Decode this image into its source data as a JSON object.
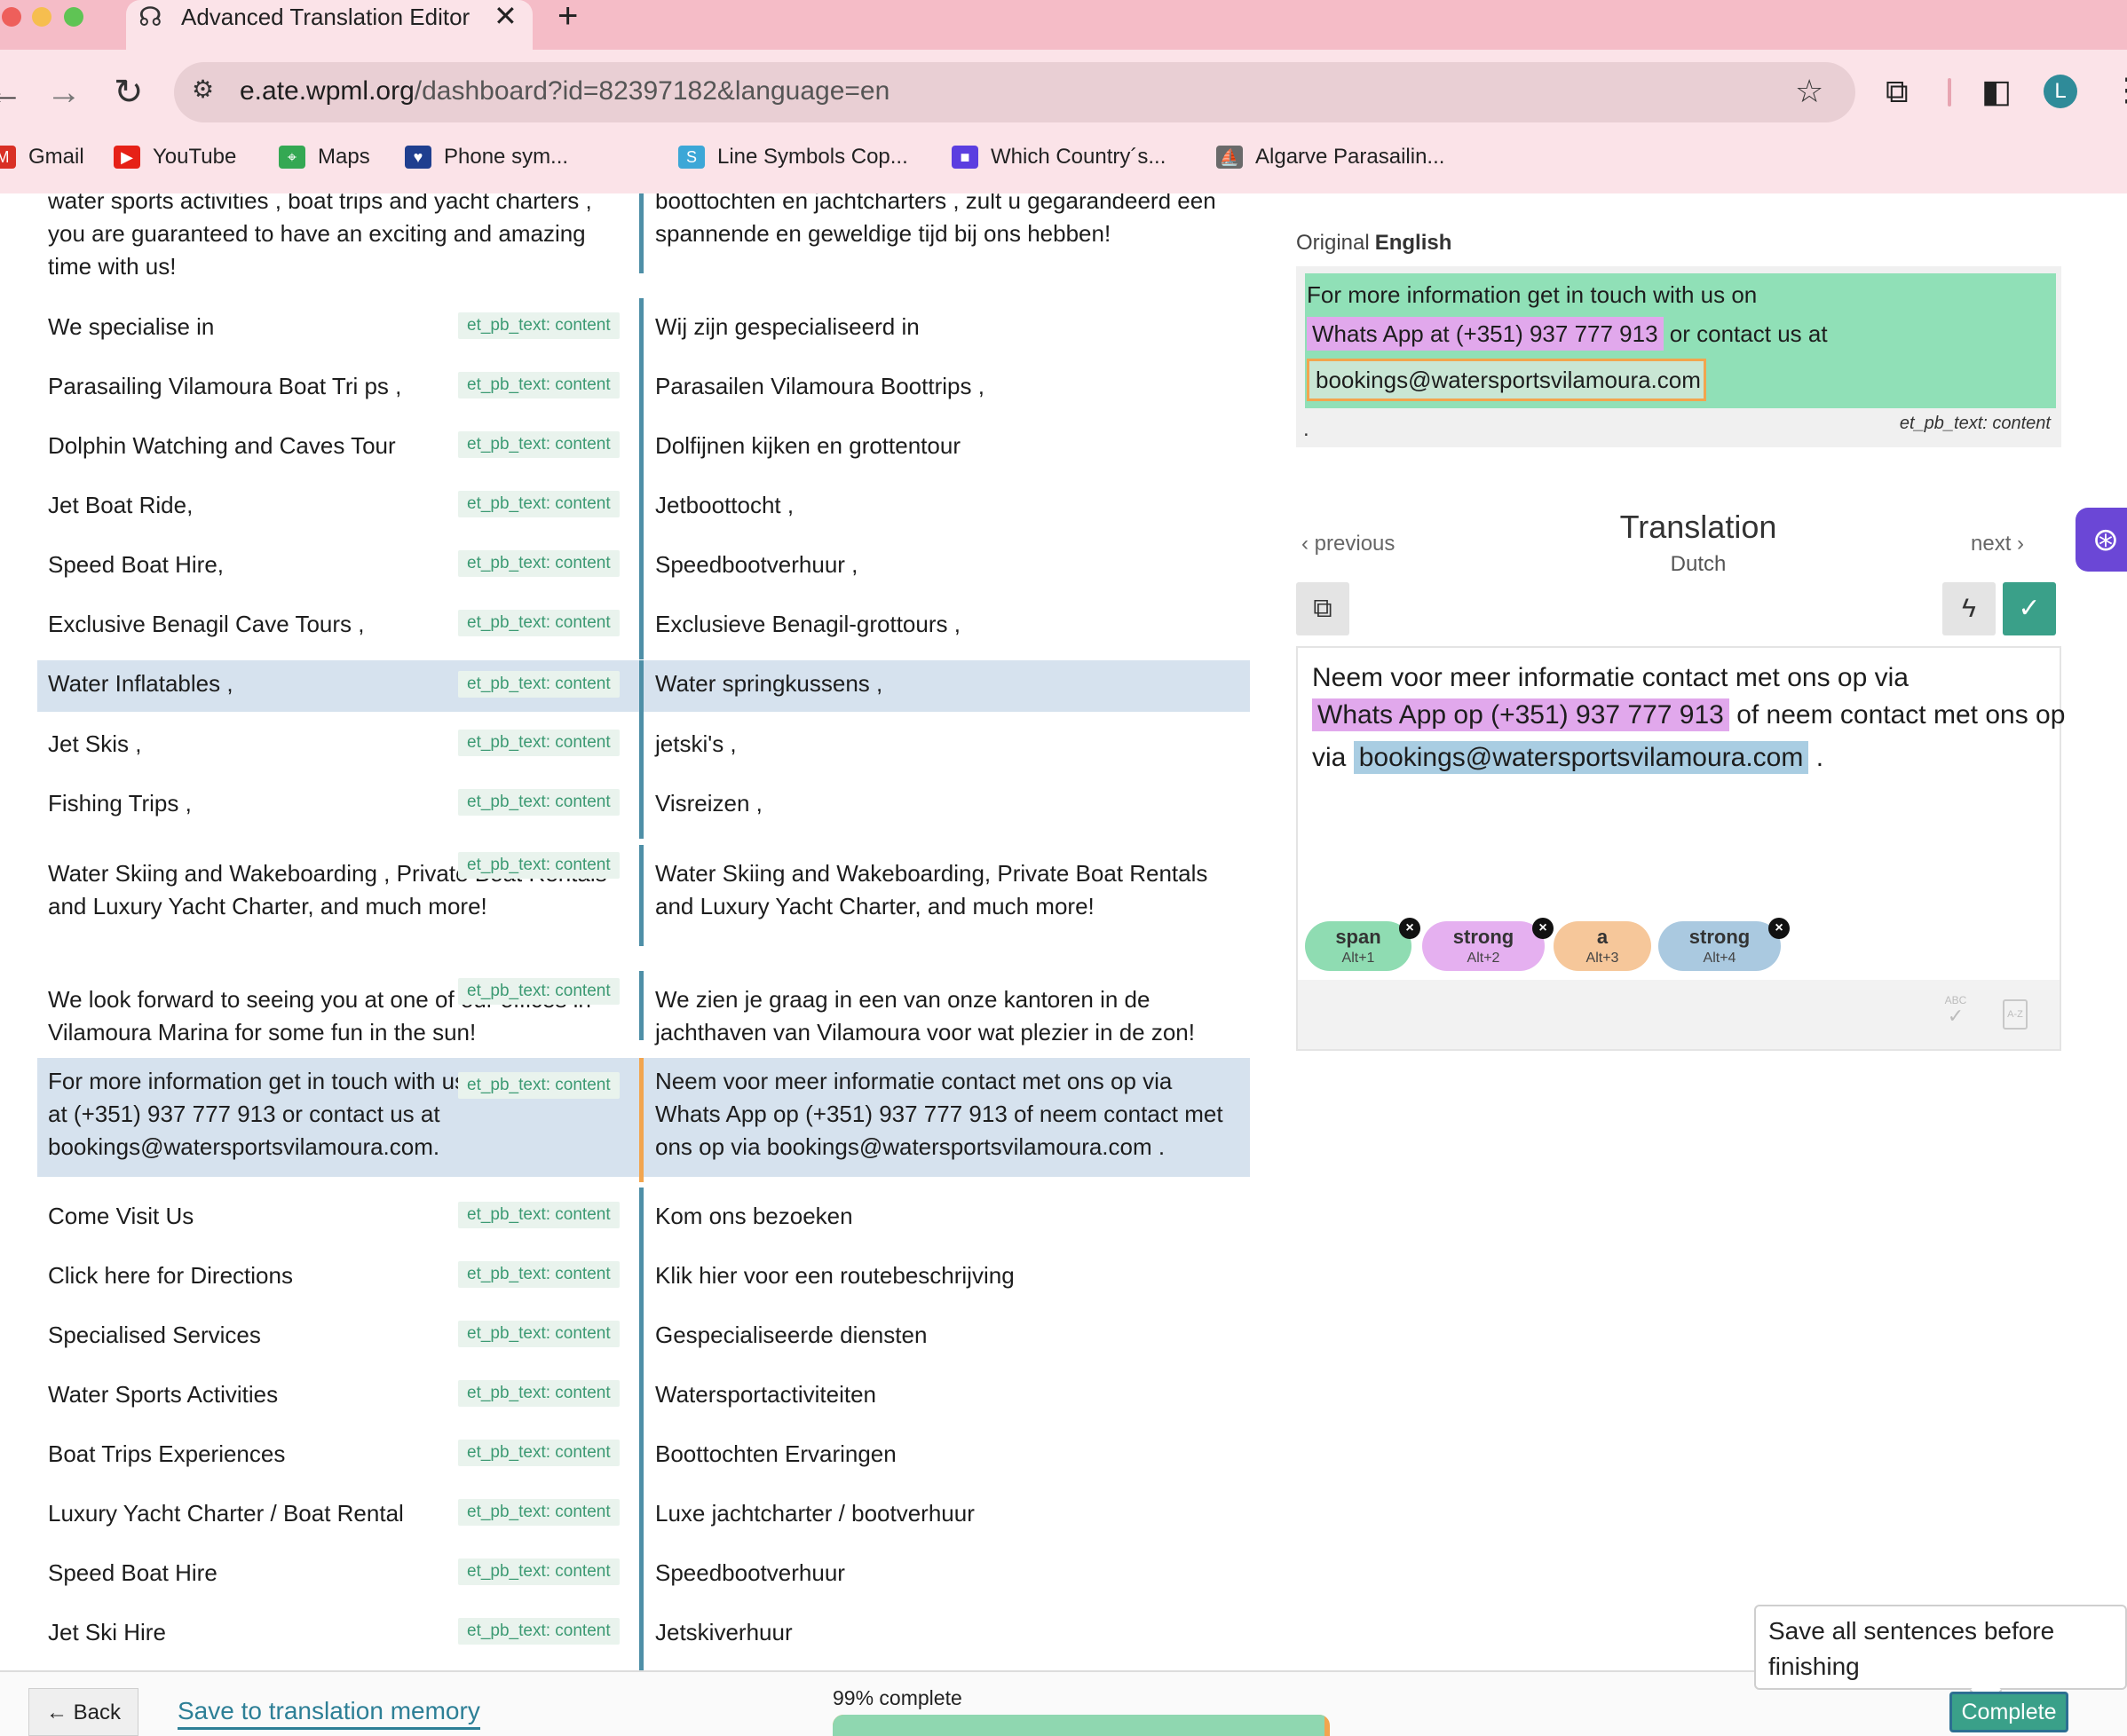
{
  "browser": {
    "tab_title": "Advanced Translation Editor",
    "url_host": "e.ate.wpml.org",
    "url_path": "/dashboard?id=82397182&language=en",
    "avatar_letter": "L",
    "bookmarks": [
      {
        "label": "Gmail",
        "icon": "gmail-icon",
        "color": "#d93025"
      },
      {
        "label": "YouTube",
        "icon": "youtube-icon",
        "color": "#e62117"
      },
      {
        "label": "Maps",
        "icon": "maps-icon",
        "color": "#34a853"
      },
      {
        "label": "Phone sym...",
        "icon": "heart-icon",
        "color": "#1f3f8f"
      },
      {
        "label": "Line Symbols Cop...",
        "icon": "s-icon",
        "color": "#3ca7d7"
      },
      {
        "label": "Which Country´s...",
        "icon": "video-icon",
        "color": "#5b3ee0"
      },
      {
        "label": "Algarve Parasailin...",
        "icon": "boat-icon",
        "color": "#6a6a6a"
      }
    ]
  },
  "segments": [
    {
      "source": "water sports activities , boat trips and yacht charters , you are guaranteed to have an exciting and amazing time with us!",
      "tag": "",
      "target": "boottochten en jachtcharters , zult u gegarandeerd een spannende en geweldige tijd bij ons hebben!"
    },
    {
      "source": "We specialise in",
      "tag": "et_pb_text: content",
      "target": "Wij zijn gespecialiseerd in"
    },
    {
      "source": "Parasailing Vilamoura Boat Tri ps ,",
      "tag": "et_pb_text: content",
      "target": "Parasailen Vilamoura Boottrips ,"
    },
    {
      "source": "Dolphin Watching and Caves Tour",
      "tag": "et_pb_text: content",
      "target": "Dolfijnen kijken en grottentour"
    },
    {
      "source": "Jet Boat Ride,",
      "tag": "et_pb_text: content",
      "target": "Jetboottocht ,"
    },
    {
      "source": "Speed Boat Hire,",
      "tag": "et_pb_text: content",
      "target": "Speedbootverhuur ,"
    },
    {
      "source": "Exclusive Benagil Cave Tours ,",
      "tag": "et_pb_text: content",
      "target": "Exclusieve Benagil-grottours ,"
    },
    {
      "source": "Water Inflatables ,",
      "tag": "et_pb_text: content",
      "target": "Water springkussens ,"
    },
    {
      "source": "Jet Skis ,",
      "tag": "et_pb_text: content",
      "target": "jetski's ,"
    },
    {
      "source": "Fishing Trips ,",
      "tag": "et_pb_text: content",
      "target": "Visreizen ,"
    },
    {
      "source": "Water Skiing and Wakeboarding , Private Boat Rentals and Luxury Yacht Charter, and much more!",
      "tag": "et_pb_text: content",
      "target": "Water Skiing and Wakeboarding, Private Boat Rentals and Luxury Yacht Charter, and much more!"
    },
    {
      "source": "We look forward to seeing you at one of our offices in Vilamoura Marina for some fun in the sun!",
      "tag": "et_pb_text: content",
      "target": "We zien je graag in een van onze kantoren in de jachthaven van Vilamoura voor wat plezier in de zon!"
    },
    {
      "source": "For more information get in touch with us on Whats App at (+351) 937 777 913 or contact us at bookings@watersportsvilamoura.com.",
      "tag": "et_pb_text: content",
      "target": "Neem voor meer informatie contact met ons op via Whats App op (+351) 937 777 913 of neem contact met ons op via bookings@watersportsvilamoura.com ."
    },
    {
      "source": "Come Visit Us",
      "tag": "et_pb_text: content",
      "target": "Kom ons bezoeken"
    },
    {
      "source": "Click here for Directions",
      "tag": "et_pb_text: content",
      "target": "Klik hier voor een routebeschrijving"
    },
    {
      "source": "Specialised Services",
      "tag": "et_pb_text: content",
      "target": "Gespecialiseerde diensten"
    },
    {
      "source": "Water Sports Activities",
      "tag": "et_pb_text: content",
      "target": "Watersportactiviteiten"
    },
    {
      "source": "Boat Trips Experiences",
      "tag": "et_pb_text: content",
      "target": "Boottochten Ervaringen"
    },
    {
      "source": "Luxury Yacht Charter / Boat Rental",
      "tag": "et_pb_text: content",
      "target": "Luxe jachtcharter / bootverhuur"
    },
    {
      "source": "Speed Boat Hire",
      "tag": "et_pb_text: content",
      "target": "Speedbootverhuur"
    },
    {
      "source": "Jet Ski Hire",
      "tag": "et_pb_text: content",
      "target": "Jetskiverhuur"
    }
  ],
  "original": {
    "label": "Original",
    "language": "English",
    "line1": "For more information get in touch with us on",
    "line2_highlight": "Whats App at (+351) 937 777 913",
    "line2_rest": "or contact us at",
    "email": "bookings@watersportsvilamoura.com",
    "trailing": ".",
    "meta": "et_pb_text: content"
  },
  "translation": {
    "title": "Translation",
    "language": "Dutch",
    "previous": "previous",
    "next": "next",
    "line1": "Neem voor meer informatie contact met ons op via",
    "line2_highlight": "Whats App op (+351) 937 777 913",
    "line2_rest": "of neem contact met ons op",
    "line3_prefix": "via",
    "email": "bookings@watersportsvilamoura.com",
    "trailing": ".",
    "chips": [
      {
        "name": "span",
        "key": "Alt+1",
        "color": "#8fdcb2"
      },
      {
        "name": "strong",
        "key": "Alt+2",
        "color": "#e5b0f0"
      },
      {
        "name": "a",
        "key": "Alt+3",
        "color": "#f6c79a"
      },
      {
        "name": "strong",
        "key": "Alt+4",
        "color": "#aac9e0"
      }
    ],
    "spellcheck_label": "ABC",
    "sort_label": "A-Z"
  },
  "footer": {
    "back": "← Back",
    "save_tm": "Save to translation memory",
    "progress_text": "99% complete",
    "progress_value": 0.99,
    "tooltip": "Save all sentences before finishing",
    "complete": "Complete"
  },
  "colors": {
    "accent": "#2d7f96",
    "tag_text": "#3c9a73",
    "selected_row": "#d6e2ee",
    "source_highlight": "#90e0b7"
  }
}
